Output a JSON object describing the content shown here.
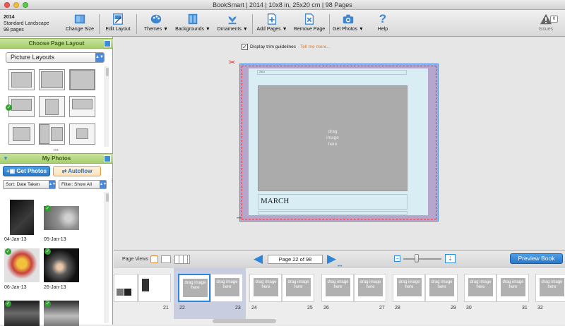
{
  "window": {
    "title": "BookSmart  |  2014  |  10x8 in, 25x20 cm  |  98 Pages"
  },
  "book_info": {
    "name": "2014",
    "format": "Standard Landscape",
    "pages": "98 pages"
  },
  "toolbar": {
    "change_size": "Change Size",
    "edit_layout": "Edit Layout",
    "themes": "Themes ▼",
    "backgrounds": "Backgrounds ▼",
    "ornaments": "Ornaments ▼",
    "add_pages": "Add Pages ▼",
    "remove_page": "Remove Page",
    "get_photos": "Get Photos ▼",
    "help": "Help",
    "issues": "Issues",
    "issues_count": "0"
  },
  "page_layout_panel": {
    "title": "Choose Page Layout",
    "select_value": "Picture Layouts"
  },
  "photos_panel": {
    "title": "My Photos",
    "get_photos": "Get Photos",
    "autoflow": "Autoflow",
    "sort": "Sort:  Date Taken",
    "filter": "Filter: Show All",
    "photos": [
      {
        "label": "04-Jan-13",
        "checked": false
      },
      {
        "label": "05-Jan-13",
        "checked": true
      },
      {
        "label": "06-Jan-13",
        "checked": true
      },
      {
        "label": "26-Jan-13",
        "checked": true
      },
      {
        "label": "",
        "checked": true
      },
      {
        "label": "",
        "checked": true
      }
    ]
  },
  "canvas": {
    "trim_label": "Display trim guidelines",
    "tell_me_more": "Tell me more...",
    "page_caption": "MARCH",
    "drag_text": "drag image here",
    "small_text": "2014"
  },
  "bottombar": {
    "page_views": "Page Views",
    "page_indicator": "Page 22 of 98",
    "preview": "Preview Book"
  },
  "filmstrip": {
    "drag_text": "drag image here",
    "page_numbers": [
      "21",
      "22",
      "23",
      "24",
      "25",
      "26",
      "27",
      "28",
      "29",
      "30",
      "31",
      "32"
    ]
  },
  "colors": {
    "accent_blue": "#2d86d9",
    "panel_green": "#a8cf6e",
    "page_purple": "#b6a6cd",
    "page_cyan": "#d9eef4"
  }
}
